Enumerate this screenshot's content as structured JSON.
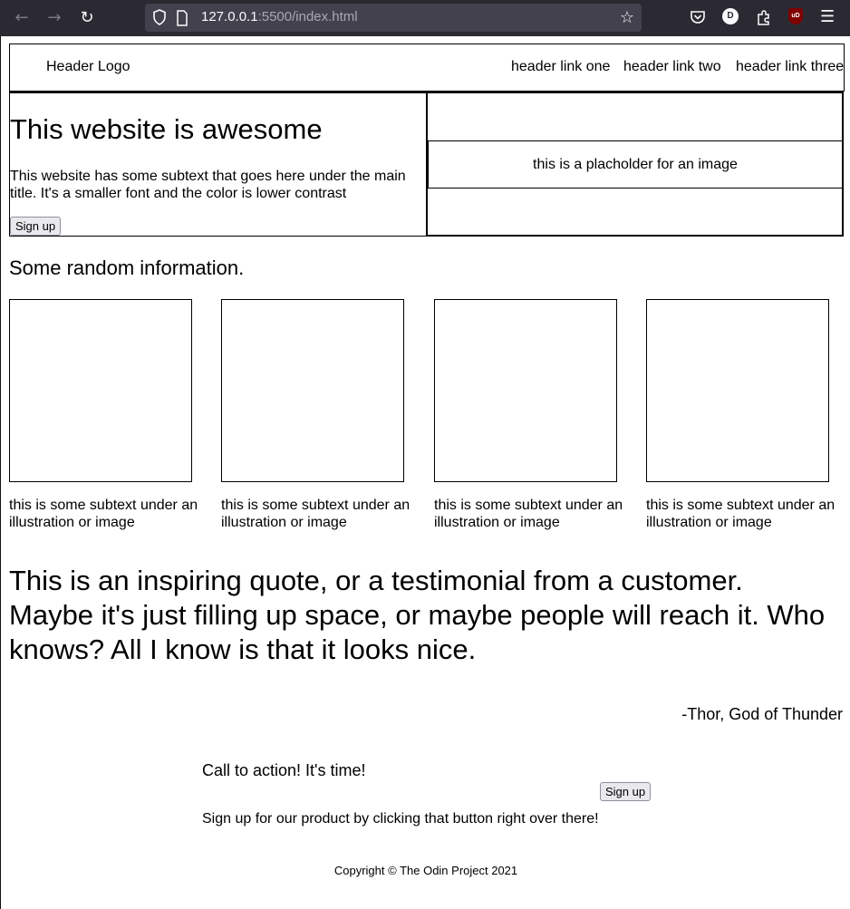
{
  "browser": {
    "url_host": "127.0.0.1",
    "url_path": ":5500/index.html",
    "avatar_letter": "D",
    "ublock_label": "uD"
  },
  "header": {
    "logo": "Header Logo",
    "links": [
      "header link one",
      "header link two",
      "header link three"
    ]
  },
  "hero": {
    "title": "This website is awesome",
    "subtext": "This website has some subtext that goes here under the main title. It's a smaller font and the color is lower contrast",
    "button": "Sign up",
    "image_placeholder": "this is a placholder for an image"
  },
  "info": {
    "title": "Some random information.",
    "cards": [
      {
        "text": "this is some subtext under an illustration or image"
      },
      {
        "text": "this is some subtext under an illustration or image"
      },
      {
        "text": "this is some subtext under an illustration or image"
      },
      {
        "text": "this is some subtext under an illustration or image"
      }
    ]
  },
  "quote": {
    "text": "This is an inspiring quote, or a testimonial from a customer. Maybe it's just filling up space, or maybe people will reach it. Who knows? All I know is that it looks nice.",
    "author": "-Thor, God of Thunder"
  },
  "cta": {
    "title": "Call to action! It's time!",
    "text": "Sign up for our product by clicking that button right over there!",
    "button": "Sign up"
  },
  "footer": {
    "copyright": "Copyright © The Odin Project 2021"
  }
}
